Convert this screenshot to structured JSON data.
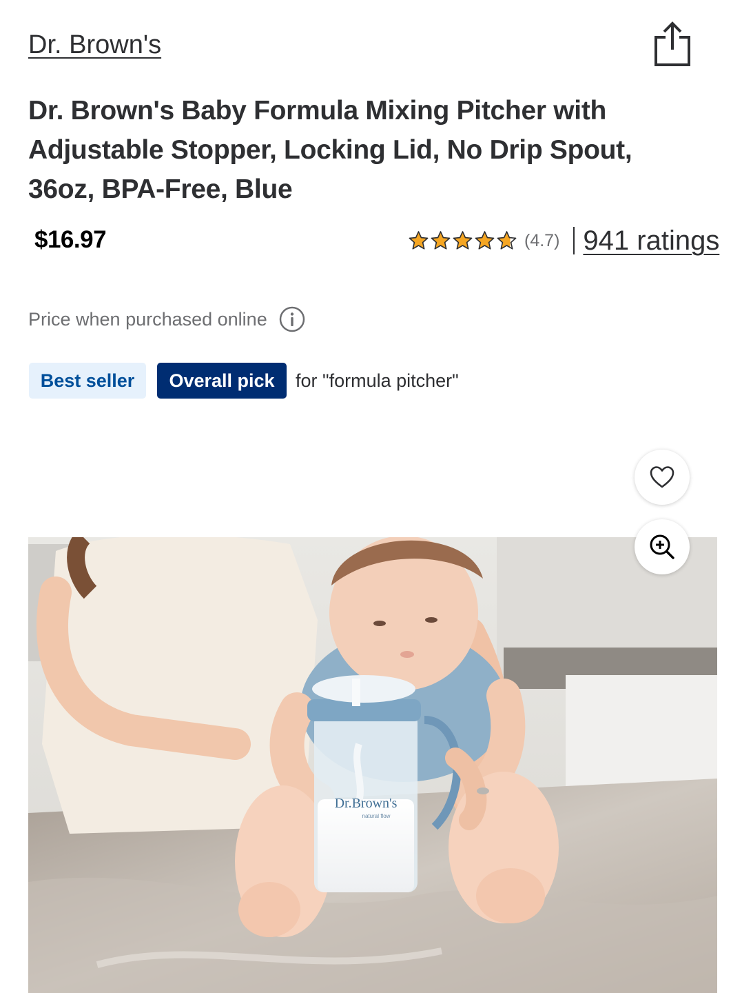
{
  "header": {
    "brand": "Dr. Brown's",
    "share_icon": "share-icon"
  },
  "product": {
    "title": "Dr. Brown's Baby Formula Mixing Pitcher with Adjustable Stopper, Locking Lid, No Drip Spout, 36oz, BPA-Free, Blue",
    "price": "$16.97",
    "price_note": "Price when purchased online",
    "rating": {
      "value": 4.7,
      "label": "(4.7)",
      "count_label": "941 ratings",
      "star_color": "#f5a623"
    },
    "badges": {
      "best_seller": "Best seller",
      "overall_pick": "Overall pick",
      "context": "for \"formula pitcher\""
    },
    "image": {
      "pitcher_brand": "Dr.Brown's",
      "pitcher_sub": "natural flow"
    }
  },
  "colors": {
    "brand_blue": "#002d72",
    "badge_light_bg": "#e6f1fc",
    "badge_light_text": "#004f9a"
  }
}
